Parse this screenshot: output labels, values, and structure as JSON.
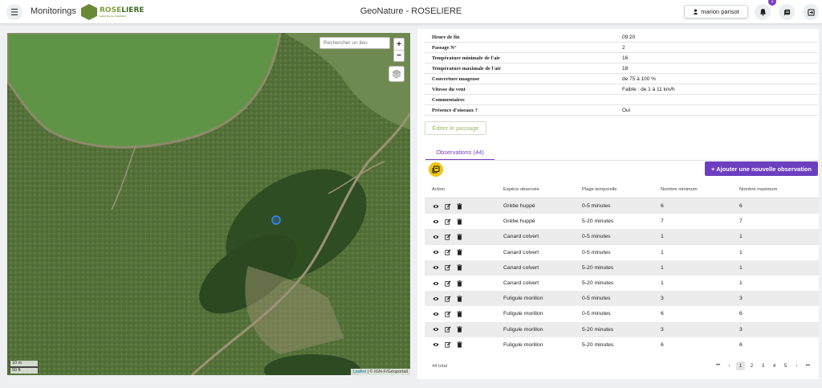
{
  "header": {
    "app_name": "Monitorings",
    "logo_text_1": "ROSE",
    "logo_text_2": "LIERE",
    "logo_sub": "suivi de la roselière",
    "title": "GeoNature - ROSELIERE",
    "user_name": "marion parisot",
    "notification_count": "1",
    "icons": [
      "menu-icon",
      "user-icon",
      "bell-icon",
      "book-icon",
      "logout-icon"
    ]
  },
  "map": {
    "search_placeholder": "Rechercher un lieu",
    "zoom_in": "+",
    "zoom_out": "−",
    "scale_m": "10 m",
    "scale_ft": "50 ft",
    "attribution_link": "Leaflet",
    "attribution_rest": "| © IGN-F/Géoportail"
  },
  "details": [
    {
      "label": "Heure de fin",
      "value": "09:20"
    },
    {
      "label": "Passage N°",
      "value": "2"
    },
    {
      "label": "Température minimale de l'air",
      "value": "16"
    },
    {
      "label": "Température maximale de l'air",
      "value": "18"
    },
    {
      "label": "Couverture nuageuse",
      "value": "de 75 à 100 %"
    },
    {
      "label": "Vitesse du vent",
      "value": "Faible : de 1 à 11 km/h"
    },
    {
      "label": "Commentaires",
      "value": ""
    },
    {
      "label": "Présence d'oiseaux ?",
      "value": "Oui"
    }
  ],
  "edit_button": "Éditer le passage",
  "tab_label": "Observations (44)",
  "add_button": "+ Ajouter une nouvelle observation",
  "table": {
    "headers": [
      "Action",
      "Espèce observée",
      "Plage temporelle",
      "Nombre minimum",
      "Nombre maximum"
    ],
    "rows": [
      [
        "Grèbe huppé",
        "0-5 minutes",
        "6",
        "6"
      ],
      [
        "Grèbe huppé",
        "5-20 minutes",
        "7",
        "7"
      ],
      [
        "Canard colvert",
        "0-5 minutes",
        "1",
        "1"
      ],
      [
        "Canard colvert",
        "0-5 minutes",
        "1",
        "1"
      ],
      [
        "Canard colvert",
        "5-20 minutes",
        "1",
        "1"
      ],
      [
        "Canard colvert",
        "5-20 minutes",
        "1",
        "1"
      ],
      [
        "Fuligule morillon",
        "0-5 minutes",
        "3",
        "3"
      ],
      [
        "Fuligule morillon",
        "0-5 minutes",
        "6",
        "6"
      ],
      [
        "Fuligule morillon",
        "5-20 minutes",
        "3",
        "3"
      ],
      [
        "Fuligule morillon",
        "5-20 minutes",
        "6",
        "6"
      ]
    ],
    "row_actions": [
      "eye-icon",
      "edit-icon",
      "trash-icon"
    ]
  },
  "footer": {
    "total": "44 total",
    "first": "⏮",
    "prev": "‹",
    "pages": [
      "1",
      "2",
      "3",
      "4",
      "5"
    ],
    "active_page": "1",
    "next": "›",
    "last": "⏭"
  },
  "colors": {
    "accent": "#7b3fbf",
    "add_button": "#6b3fbf",
    "table_toggle": "#f2c511",
    "edit_text": "#9ab86a"
  }
}
